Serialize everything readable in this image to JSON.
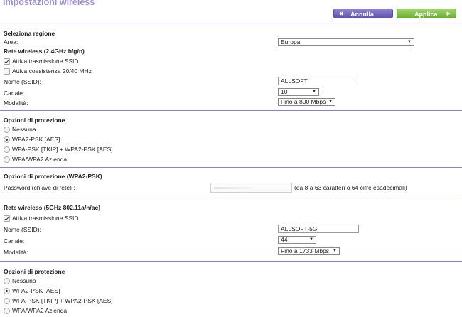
{
  "header": {
    "title": "Impostazioni wireless",
    "cancel_label": "Annulla",
    "apply_label": "Applica"
  },
  "region": {
    "heading": "Seleziona regione",
    "area_label": "Area:",
    "area_value": "Europa"
  },
  "wireless_24": {
    "heading": "Rete wireless (2.4GHz b/g/n)",
    "ssid_broadcast_label": "Attiva trasmissione SSID",
    "ssid_broadcast_checked": true,
    "coexistence_label": "Attiva coesistenza 20/40 MHz",
    "coexistence_checked": false,
    "ssid_label": "Nome (SSID):",
    "ssid_value": "ALLSOFT",
    "channel_label": "Canale:",
    "channel_value": "10",
    "mode_label": "Modalità:",
    "mode_value": "Fino a 800 Mbps"
  },
  "security_24": {
    "heading": "Opzioni di protezione",
    "options": [
      {
        "label": "Nessuna",
        "selected": false
      },
      {
        "label": "WPA2-PSK [AES]",
        "selected": true
      },
      {
        "label": "WPA-PSK [TKIP] + WPA2-PSK [AES]",
        "selected": false
      },
      {
        "label": "WPA/WPA2 Azienda",
        "selected": false
      }
    ]
  },
  "wpa2_psk": {
    "heading": "Opzioni di protezione (WPA2-PSK)",
    "password_label": "Password (chiave di rete) :",
    "password_hint": "(da 8 a 63 caratteri o 64 cifre esadecimali)"
  },
  "wireless_5": {
    "heading": "Rete wireless (5GHz 802.11a/n/ac)",
    "ssid_broadcast_label": "Attiva trasmissione SSID",
    "ssid_broadcast_checked": true,
    "ssid_label": "Nome (SSID):",
    "ssid_value": "ALLSOFT-5G",
    "channel_label": "Canale:",
    "channel_value": "44",
    "mode_label": "Modalità:",
    "mode_value": "Fino a 1733 Mbps"
  },
  "security_5": {
    "heading": "Opzioni di protezione",
    "options": [
      {
        "label": "Nessuna",
        "selected": false
      },
      {
        "label": "WPA2-PSK [AES]",
        "selected": true
      },
      {
        "label": "WPA-PSK [TKIP] + WPA2-PSK [AES]",
        "selected": false
      },
      {
        "label": "WPA/WPA2 Azienda",
        "selected": false
      }
    ]
  },
  "colors": {
    "title": "#9b8fd0",
    "divider": "#8d7fc9",
    "cancel_button": "#6253ad",
    "apply_button": "#6cae32"
  },
  "icons": {
    "cancel": "close-icon",
    "apply": "arrow-right-icon",
    "dropdown": "chevron-down-icon"
  }
}
